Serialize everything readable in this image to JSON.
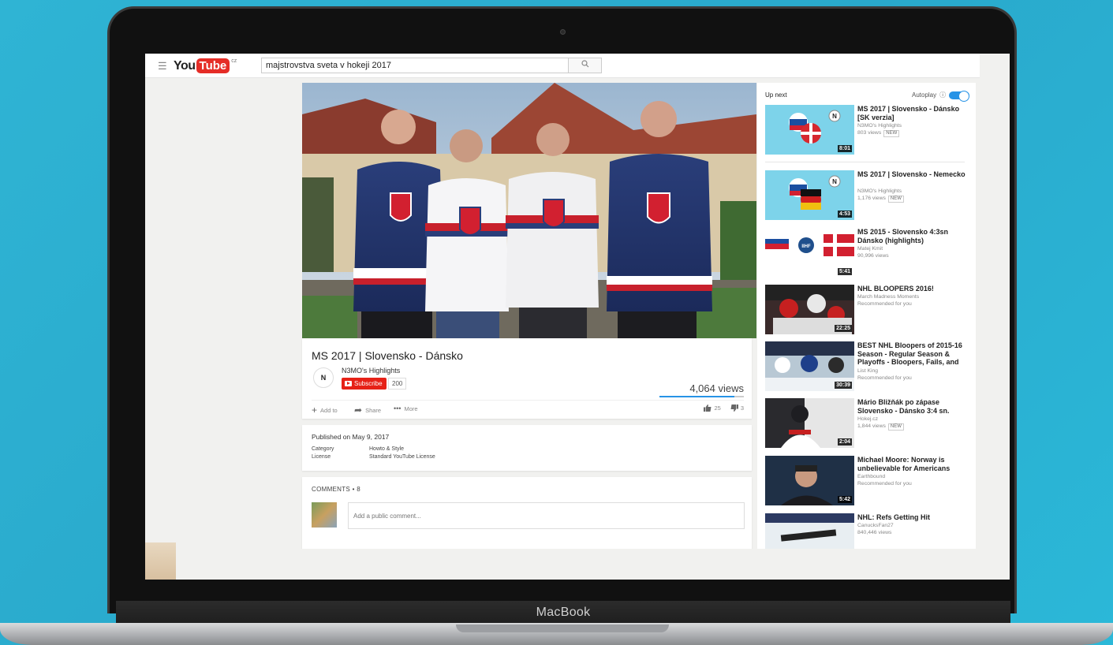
{
  "device": {
    "label": "MacBook"
  },
  "header": {
    "logo_you": "You",
    "logo_tube": "Tube",
    "logo_region": "cz",
    "search_value": "majstrovstva sveta v hokeji 2017"
  },
  "video": {
    "title": "MS 2017 | Slovensko - Dánsko",
    "channel": "N3MO's Highlights",
    "channel_avatar_letter": "N",
    "subscribe_label": "Subscribe",
    "subscriber_count": "200",
    "views": "4,064 views",
    "like_ratio": 0.89,
    "actions": {
      "add_to": "Add to",
      "share": "Share",
      "more": "More"
    },
    "likes": "25",
    "dislikes": "3"
  },
  "meta": {
    "published": "Published on May 9, 2017",
    "category_label": "Category",
    "category_value": "Howto & Style",
    "license_label": "License",
    "license_value": "Standard YouTube License"
  },
  "comments": {
    "header": "COMMENTS • 8",
    "placeholder": "Add a public comment..."
  },
  "sidebar": {
    "up_next": "Up next",
    "autoplay": "Autoplay",
    "items": [
      {
        "title": "MS 2017 | Slovensko - Dánsko [SK verzia]",
        "channel": "N3MO's Highlights",
        "views": "803 views",
        "badge": "NEW",
        "duration": "8:01"
      },
      {
        "title": "MS 2017 | Slovensko - Nemecko",
        "channel": "N3MO's Highlights",
        "views": "1,176 views",
        "badge": "NEW",
        "duration": "4:53"
      },
      {
        "title": "MS 2015 - Slovensko 4:3sn Dánsko (highlights)",
        "channel": "Matej Kmit",
        "views": "90,996 views",
        "badge": "",
        "duration": "5:41"
      },
      {
        "title": "NHL BLOOPERS 2016!",
        "channel": "March Madness Moments",
        "views": "Recommended for you",
        "badge": "",
        "duration": "22:25"
      },
      {
        "title": "BEST NHL Bloopers of 2015-16 Season - Regular Season & Playoffs - Bloopers, Fails, and",
        "channel": "List King",
        "views": "Recommended for you",
        "badge": "",
        "duration": "30:39"
      },
      {
        "title": "Mário Bližňák po zápase Slovensko - Dánsko 3:4 sn.",
        "channel": "Hokej.cz",
        "views": "1,844 views",
        "badge": "NEW",
        "duration": "2:04"
      },
      {
        "title": "Michael Moore: Norway is unbelievable for Americans",
        "channel": "Earthbound",
        "views": "Recommended for you",
        "badge": "",
        "duration": "5:42"
      },
      {
        "title": "NHL: Refs Getting Hit",
        "channel": "CanucksFan27",
        "views": "840,446 views",
        "badge": "",
        "duration": ""
      }
    ]
  },
  "icons": {
    "menu": "hamburger-icon",
    "search": "search-icon",
    "add": "plus-icon",
    "share": "share-arrow-icon",
    "more": "dots-icon",
    "like": "thumbs-up-icon",
    "dislike": "thumbs-down-icon"
  },
  "colors": {
    "youtube_red": "#e52d27",
    "subscribe_red": "#e62117",
    "accent_blue": "#2793e6"
  }
}
